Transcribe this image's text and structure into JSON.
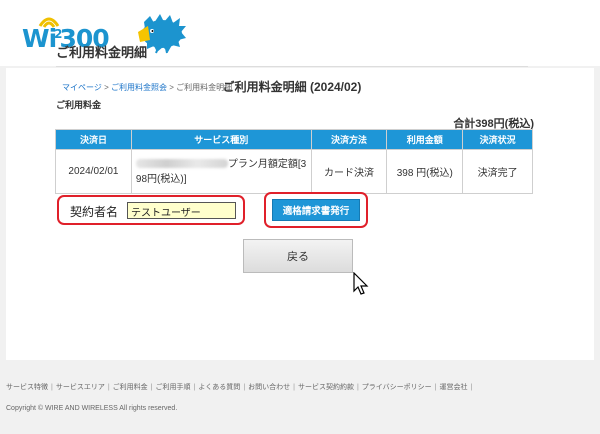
{
  "header": {
    "logo_text": "Wi²300",
    "logo_prefix": "Wi",
    "logo_sup": "2",
    "logo_suffix": "300"
  },
  "breadcrumb": {
    "items": [
      "マイページ",
      "ご利用料金照会",
      "ご利用料金明細"
    ],
    "separator": ">"
  },
  "page": {
    "title": "ご利用料金明細",
    "statement_title": "ご利用料金明細 (2024/02)",
    "usage_label": "ご利用料金",
    "total": "合計398円(税込)"
  },
  "table": {
    "headers": [
      "決済日",
      "サービス種別",
      "決済方法",
      "利用金額",
      "決済状況"
    ],
    "rows": [
      {
        "date": "2024/02/01",
        "service": "プラン月額定額[398円(税込)]",
        "service_line1": "プラン月額定額[3",
        "service_line2": "98円(税込)]",
        "method": "カード決済",
        "amount": "398 円(税込)",
        "status": "決済完了"
      }
    ]
  },
  "contract": {
    "label": "契約者名",
    "value": "テストユーザー"
  },
  "buttons": {
    "invoice": "適格請求書発行",
    "back": "戻る"
  },
  "footer": {
    "links": [
      "サービス特徴",
      "サービスエリア",
      "ご利用料金",
      "ご利用手順",
      "よくある質問",
      "お問い合わせ",
      "サービス契約約款",
      "プライバシーポリシー",
      "運営会社"
    ],
    "copyright": "Copyright © WIRE AND WIRELESS All rights reserved."
  },
  "colors": {
    "accent": "#1e96d7",
    "highlight": "#e0202a",
    "input_bg": "#ffffcc"
  }
}
